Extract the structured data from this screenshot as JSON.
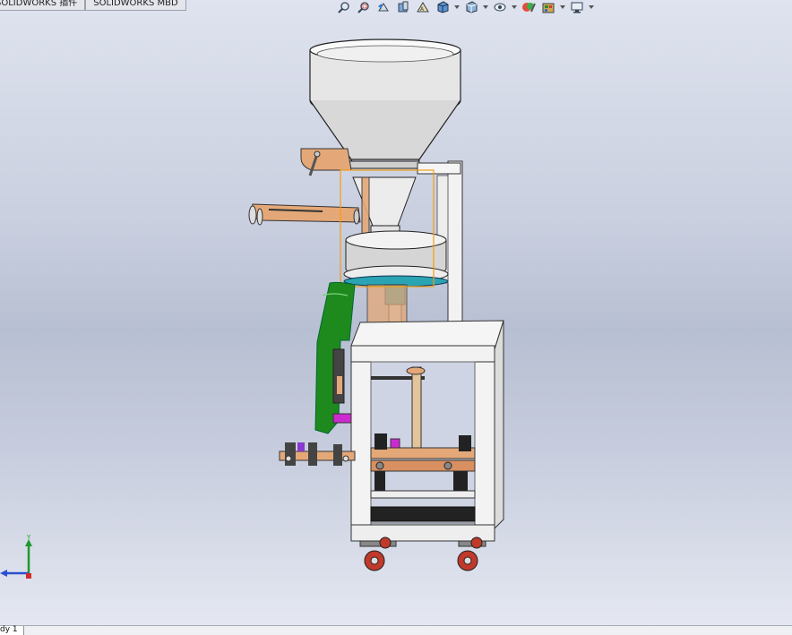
{
  "command_tabs": [
    {
      "label": "SOLIDWORKS 插件"
    },
    {
      "label": "SOLIDWORKS MBD"
    }
  ],
  "view_toolbar": {
    "buttons": [
      {
        "icon": "zoom-to-fit-icon"
      },
      {
        "icon": "zoom-to-area-icon"
      },
      {
        "icon": "previous-view-icon"
      },
      {
        "icon": "section-view-icon"
      },
      {
        "icon": "dynamic-annotation-views-icon"
      },
      {
        "icon": "view-orientation-icon",
        "has_dropdown": true
      },
      {
        "icon": "display-style-icon",
        "has_dropdown": true
      },
      {
        "icon": "hide-show-items-icon",
        "has_dropdown": true
      },
      {
        "icon": "edit-appearance-icon"
      },
      {
        "icon": "apply-scene-icon",
        "has_dropdown": true
      },
      {
        "icon": "view-settings-icon",
        "has_dropdown": true
      }
    ]
  },
  "triad": {
    "y_label": "Y"
  },
  "bottom_tab": {
    "label": "dy 1"
  },
  "colors": {
    "frame": "#f2f2f2",
    "bracket": "#e4a878",
    "chute": "#1e8a1e",
    "shaft": "#2aa3b3",
    "caster": "#c0392b",
    "selection": "#f39c12"
  }
}
